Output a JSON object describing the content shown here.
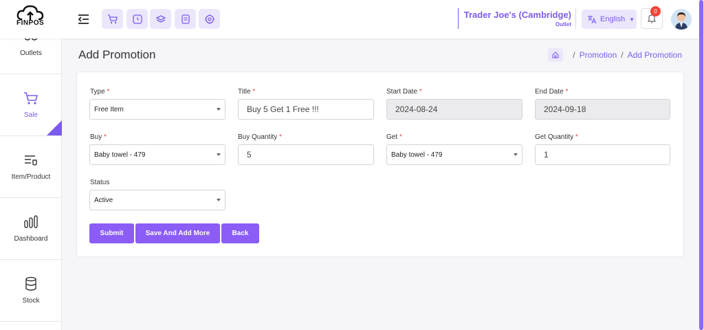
{
  "header": {
    "logo_text": "FINPOS",
    "outlet_name": "Trader Joe's (Cambridge)",
    "outlet_subtitle": "Outlet",
    "language": "English",
    "notification_count": "0",
    "quick_actions": [
      "cart-icon",
      "clock-icon",
      "layers-icon",
      "receipt-icon",
      "settings-icon"
    ]
  },
  "sidebar": {
    "items": [
      {
        "label": "Outlets",
        "icon": "outlets-icon"
      },
      {
        "label": "Sale",
        "icon": "cart-icon",
        "active": true
      },
      {
        "label": "Item/Product",
        "icon": "item-list-icon"
      },
      {
        "label": "Dashboard",
        "icon": "bar-chart-icon"
      },
      {
        "label": "Stock",
        "icon": "database-icon"
      }
    ]
  },
  "page": {
    "title": "Add Promotion",
    "breadcrumb": [
      "Promotion",
      "Add Promotion"
    ]
  },
  "form": {
    "type": {
      "label": "Type",
      "value": "Free Item"
    },
    "title": {
      "label": "Title",
      "value": "Buy 5 Get 1 Free !!!"
    },
    "start_date": {
      "label": "Start Date",
      "value": "2024-08-24"
    },
    "end_date": {
      "label": "End Date",
      "value": "2024-09-18"
    },
    "buy": {
      "label": "Buy",
      "value": "Baby towel - 479"
    },
    "buy_quantity": {
      "label": "Buy Quantity",
      "value": "5"
    },
    "get": {
      "label": "Get",
      "value": "Baby towel - 479"
    },
    "get_quantity": {
      "label": "Get Quantity",
      "value": "1"
    },
    "status": {
      "label": "Status",
      "value": "Active"
    },
    "required_mark": "*"
  },
  "actions": {
    "submit": "Submit",
    "save_and_add_more": "Save And Add More",
    "back": "Back"
  },
  "colors": {
    "accent": "#7c5bea",
    "button": "#8b5cf6",
    "required": "#e0424b"
  }
}
